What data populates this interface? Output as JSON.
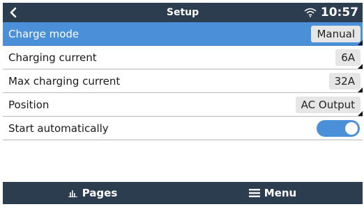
{
  "header": {
    "title": "Setup",
    "time": "10:57",
    "back_icon": "chevron-left-icon",
    "wifi_icon": "wifi-icon"
  },
  "settings": [
    {
      "label": "Charge mode",
      "value": "Manual",
      "selected": true
    },
    {
      "label": "Charging current",
      "value": "6A",
      "selected": false
    },
    {
      "label": "Max charging current",
      "value": "32A",
      "selected": false
    },
    {
      "label": "Position",
      "value": "AC Output",
      "selected": false
    },
    {
      "label": "Start automatically",
      "toggle_on": true,
      "selected": false
    }
  ],
  "footer": {
    "pages_label": "Pages",
    "menu_label": "Menu",
    "pages_icon": "bar-chart-icon",
    "menu_icon": "hamburger-menu-icon"
  },
  "colors": {
    "header_bg": "#2b3d4f",
    "selected_row": "#4a90d9",
    "toggle_on": "#4a90d9",
    "value_box": "#e6e6e6"
  }
}
